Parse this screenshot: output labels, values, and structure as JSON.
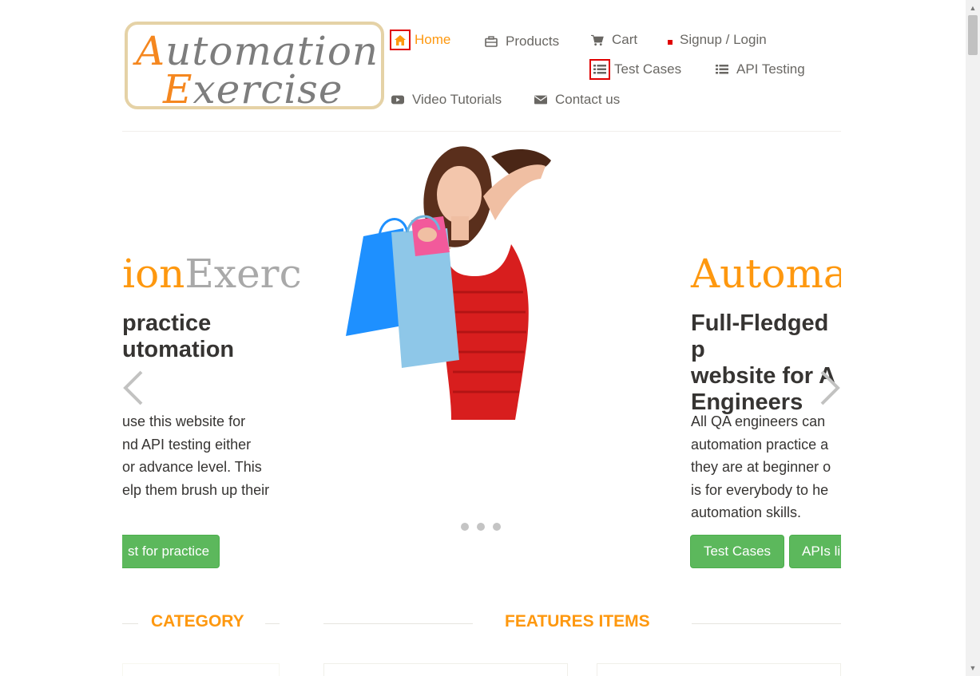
{
  "logo": {
    "line1_cap": "A",
    "line1_rest": "utomation",
    "line2_cap": "E",
    "line2_rest": "xercise"
  },
  "nav": {
    "home": "Home",
    "products": "Products",
    "cart": "Cart",
    "signup_login": "Signup / Login",
    "test_cases": "Test Cases",
    "api_testing": "API Testing",
    "video_tutorials": "Video Tutorials",
    "contact_us": "Contact us"
  },
  "slider": {
    "left": {
      "brand_orange": "tion",
      "brand_grey": "Exerc",
      "heading": "practice\nutomation",
      "text": " use this website for\nnd API testing either\nor advance level. This\nelp them brush up their",
      "button": "st for practice"
    },
    "right": {
      "brand": "Automa",
      "heading": "Full-Fledged p\nwebsite for A\nEngineers",
      "text": "All QA engineers can\nautomation practice a\nthey are at beginner o\nis for everybody to he\nautomation skills.",
      "button_test_cases": "Test Cases",
      "button_apis": "APIs li"
    },
    "prev_arrow": "‹",
    "next_arrow": "›",
    "indicator_count": 3
  },
  "sections": {
    "category": "CATEGORY",
    "features_items": "FEATURES ITEMS"
  },
  "colors": {
    "accent": "#fe980f",
    "button_green": "#5cb85c",
    "highlight_box": "#e00000"
  },
  "icons": [
    "home-icon",
    "briefcase-icon",
    "cart-icon",
    "list-icon",
    "play-icon",
    "envelope-icon"
  ]
}
